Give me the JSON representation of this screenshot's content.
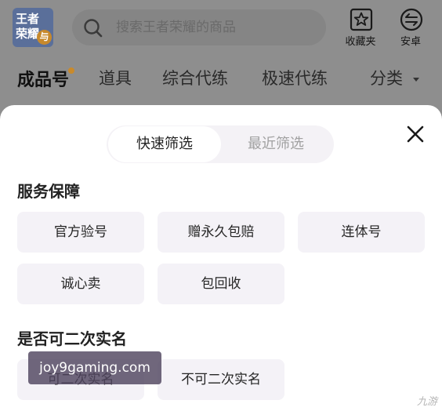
{
  "header": {
    "logo_text": "王者荣耀",
    "logo_badge": "与",
    "search_placeholder": "搜索王者荣耀的商品",
    "favorites_label": "收藏夹",
    "platform_label": "安卓"
  },
  "category_tabs": [
    {
      "label": "成品号",
      "active": true
    },
    {
      "label": "道具",
      "active": false
    },
    {
      "label": "综合代练",
      "active": false
    },
    {
      "label": "极速代练",
      "active": false
    },
    {
      "label": "分类",
      "active": false
    }
  ],
  "filter_sheet": {
    "segments": [
      "快速筛选",
      "最近筛选"
    ],
    "sections": [
      {
        "title": "服务保障",
        "options": [
          "官方验号",
          "赠永久包赔",
          "连体号",
          "诚心卖",
          "包回收"
        ]
      },
      {
        "title": "是否可二次实名",
        "options": [
          "可二次实名",
          "不可二次实名"
        ]
      }
    ]
  },
  "overlay": {
    "watermark": "joy9gaming.com",
    "corner_logo": "九游"
  },
  "colors": {
    "dim_background": "#8e8e8e",
    "sheet_background": "#ffffff",
    "chip_background": "#f4f2f7",
    "accent_dot": "#c98a2b"
  }
}
